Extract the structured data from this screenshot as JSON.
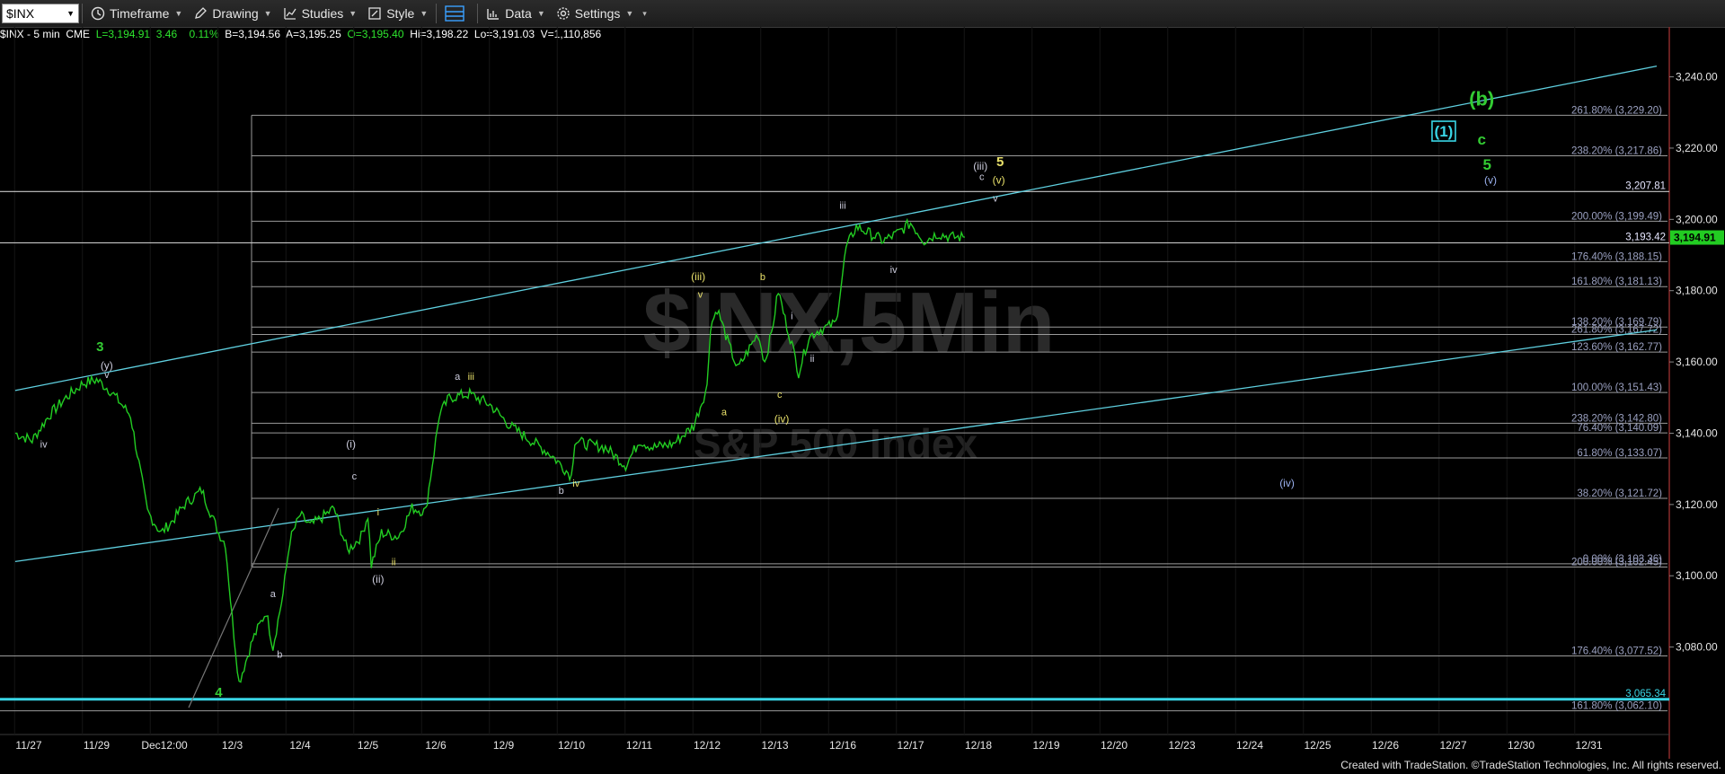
{
  "toolbar": {
    "symbol": "$INX",
    "items": [
      {
        "label": "Timeframe",
        "icon": "clock-icon"
      },
      {
        "label": "Drawing",
        "icon": "pencil-icon"
      },
      {
        "label": "Studies",
        "icon": "studies-icon"
      },
      {
        "label": "Style",
        "icon": "style-icon"
      },
      {
        "label": "Data",
        "icon": "data-icon"
      },
      {
        "label": "Settings",
        "icon": "gear-icon"
      }
    ]
  },
  "info": {
    "name": "$INX - 5 min  CME",
    "last": "L=3,194.91",
    "chg": "3.46",
    "pct": "0.11%",
    "bid": "B=3,194.56",
    "ask": "A=3,195.25",
    "open": "O=3,195.40",
    "hi": "Hi=3,198.22",
    "lo": "Lo=3,191.03",
    "vol": "V=1,110,856"
  },
  "watermark": {
    "symbol": "$INX,5Min",
    "name": "S&P 500 Index"
  },
  "footer": "Created with TradeStation. ©TradeStation Technologies, Inc. All rights reserved.",
  "colors": {
    "price": "#22cc22",
    "axis": "#8a2a2a",
    "channel": "#5fd0e0",
    "fib": "#9a9a9a",
    "cyan": "#39d6e6"
  },
  "chart_data": {
    "type": "line",
    "title": "$INX - 5 min",
    "ylim": [
      3060,
      3254
    ],
    "y_ticks": [
      "3,240.00",
      "3,220.00",
      "3,200.00",
      "3,180.00",
      "3,160.00",
      "3,140.00",
      "3,120.00",
      "3,100.00",
      "3,080.00"
    ],
    "y_tick_values": [
      3240,
      3220,
      3200,
      3180,
      3160,
      3140,
      3120,
      3100,
      3080
    ],
    "x_labels": [
      "11/27",
      "11/29",
      "Dec12:00",
      "12/3",
      "12/4",
      "12/5",
      "12/6",
      "12/9",
      "12/10",
      "12/11",
      "12/12",
      "12/13",
      "12/16",
      "12/17",
      "12/18",
      "12/19",
      "12/20",
      "12/23",
      "12/24",
      "12/25",
      "12/26",
      "12/27",
      "12/30",
      "12/31"
    ],
    "x_label_index": [
      0,
      1,
      2,
      3,
      4,
      5,
      6,
      7,
      8,
      9,
      10,
      11,
      12,
      13,
      14,
      15,
      16,
      17,
      18,
      19,
      20,
      21,
      22,
      23
    ],
    "series": [
      {
        "values_x": [
          -0.2,
          0.05,
          0.3,
          0.55,
          0.8,
          1.0,
          1.2,
          1.5,
          1.75,
          1.95,
          2.1,
          2.3,
          2.55,
          2.8,
          2.9,
          3.0,
          3.1,
          3.3,
          3.5,
          3.6,
          3.75,
          3.85,
          4.0,
          4.15,
          4.3,
          4.5,
          4.7,
          4.9,
          5.0,
          5.05,
          5.2,
          5.45,
          5.65,
          5.85,
          6.0,
          6.05,
          6.2,
          6.5,
          6.8,
          7.1,
          7.4,
          7.7,
          8.0,
          8.05,
          8.2,
          8.5,
          8.8,
          8.95,
          9.0,
          9.2,
          9.5,
          9.8,
          10.0,
          10.05,
          10.15,
          10.3,
          10.45,
          10.6,
          10.75,
          10.85,
          10.95,
          11.05,
          11.15,
          11.25,
          11.35,
          11.5,
          11.65,
          11.8,
          11.9,
          12.0,
          12.05,
          12.2,
          12.4,
          12.6,
          12.8,
          13.0,
          13.2,
          13.4,
          13.6,
          13.8
        ],
        "values_y": [
          3140,
          3138,
          3145,
          3150,
          3154,
          3155,
          3152,
          3145,
          3118,
          3112,
          3115,
          3120,
          3124,
          3112,
          3109,
          3088,
          3070,
          3082,
          3090,
          3080,
          3095,
          3110,
          3117,
          3114,
          3116,
          3119,
          3107,
          3111,
          3117,
          3103,
          3112,
          3111,
          3119,
          3118,
          3138,
          3145,
          3150,
          3151,
          3148,
          3142,
          3138,
          3134,
          3128,
          3138,
          3137,
          3136,
          3131,
          3136,
          3138,
          3136,
          3137,
          3142,
          3153,
          3170,
          3175,
          3166,
          3158,
          3163,
          3168,
          3160,
          3168,
          3180,
          3172,
          3165,
          3157,
          3167,
          3169,
          3170,
          3171,
          3185,
          3192,
          3198,
          3196,
          3194,
          3196,
          3199,
          3194,
          3196,
          3195,
          3195
        ]
      }
    ],
    "fib_levels": [
      {
        "label": "261.80% (3,229.20)",
        "value": 3229.2
      },
      {
        "label": "238.20% (3,217.86)",
        "value": 3217.86
      },
      {
        "label": "200.00% (3,199.49)",
        "value": 3199.49
      },
      {
        "label": "176.40% (3,188.15)",
        "value": 3188.15
      },
      {
        "label": "161.80% (3,181.13)",
        "value": 3181.13
      },
      {
        "label": "138.20% (3,169.79)",
        "value": 3169.79
      },
      {
        "label": "261.80% (3,167.72)",
        "value": 3167.72
      },
      {
        "label": "123.60% (3,162.77)",
        "value": 3162.77
      },
      {
        "label": "100.00% (3,151.43)",
        "value": 3151.43
      },
      {
        "label": "238.20% (3,142.80)",
        "value": 3142.8
      },
      {
        "label": "76.40% (3,140.09)",
        "value": 3140.09
      },
      {
        "label": "61.80% (3,133.07)",
        "value": 3133.07
      },
      {
        "label": "38.20% (3,121.72)",
        "value": 3121.72
      },
      {
        "label": "0.00% (3,103.36)",
        "value": 3103.36
      },
      {
        "label": "200.00% (3,102.45)",
        "value": 3102.45
      },
      {
        "label": "176.40% (3,077.52)",
        "value": 3077.52
      },
      {
        "label": "161.80% (3,062.10)",
        "value": 3062.1
      }
    ],
    "horizontal_lines": [
      {
        "label": "3,207.81",
        "value": 3207.81
      },
      {
        "label": "3,193.42",
        "value": 3193.42
      },
      {
        "label": "3,065.34",
        "value": 3065.34
      }
    ],
    "last_price": {
      "label": "3,194.91",
      "value": 3194.91
    },
    "channel_lines": [
      {
        "x": [
          -0.2,
          24.0
        ],
        "y": [
          3152,
          3243
        ]
      },
      {
        "x": [
          -0.2,
          24.0
        ],
        "y": [
          3104,
          3169
        ]
      }
    ],
    "annotations": [
      {
        "text": "3",
        "x": 1.05,
        "y": 3163,
        "color": "#33cc33",
        "size": 15
      },
      {
        "text": "(y)",
        "x": 1.15,
        "y": 3158,
        "color": "#ccccdd",
        "size": 12
      },
      {
        "text": "v",
        "x": 1.15,
        "y": 3155.5,
        "color": "#ccccdd",
        "size": 11
      },
      {
        "text": "iv",
        "x": 0.22,
        "y": 3136,
        "color": "#ccccdd",
        "size": 11
      },
      {
        "text": "4",
        "x": 2.8,
        "y": 3066,
        "color": "#33cc33",
        "size": 15
      },
      {
        "text": "a",
        "x": 3.6,
        "y": 3094,
        "color": "#ccccdd",
        "size": 11
      },
      {
        "text": "b",
        "x": 3.7,
        "y": 3077,
        "color": "#ccccdd",
        "size": 11
      },
      {
        "text": "(i)",
        "x": 4.75,
        "y": 3136,
        "color": "#ccccdd",
        "size": 12
      },
      {
        "text": "c",
        "x": 4.8,
        "y": 3127,
        "color": "#ccccdd",
        "size": 11
      },
      {
        "text": "i",
        "x": 5.15,
        "y": 3117,
        "color": "#e8e06a",
        "size": 11
      },
      {
        "text": "ii",
        "x": 5.38,
        "y": 3103,
        "color": "#e8e06a",
        "size": 11
      },
      {
        "text": "(ii)",
        "x": 5.15,
        "y": 3098,
        "color": "#ccccdd",
        "size": 12
      },
      {
        "text": "a",
        "x": 6.32,
        "y": 3155,
        "color": "#ccccdd",
        "size": 11
      },
      {
        "text": "iii",
        "x": 6.52,
        "y": 3155,
        "color": "#e8e06a",
        "size": 11
      },
      {
        "text": "b",
        "x": 7.85,
        "y": 3123,
        "color": "#ccccdd",
        "size": 11
      },
      {
        "text": "iv",
        "x": 8.07,
        "y": 3125,
        "color": "#e8e06a",
        "size": 11
      },
      {
        "text": "(iii)",
        "x": 9.87,
        "y": 3183,
        "color": "#e8e06a",
        "size": 12
      },
      {
        "text": "v",
        "x": 9.9,
        "y": 3178,
        "color": "#e8e06a",
        "size": 11
      },
      {
        "text": "a",
        "x": 10.25,
        "y": 3145,
        "color": "#e8e06a",
        "size": 11
      },
      {
        "text": "b",
        "x": 10.82,
        "y": 3183,
        "color": "#e8e06a",
        "size": 11
      },
      {
        "text": "i",
        "x": 11.25,
        "y": 3172,
        "color": "#ccccdd",
        "size": 11
      },
      {
        "text": "ii",
        "x": 11.55,
        "y": 3160,
        "color": "#ccccdd",
        "size": 11
      },
      {
        "text": "c",
        "x": 11.07,
        "y": 3150,
        "color": "#e8e06a",
        "size": 11
      },
      {
        "text": "(iv)",
        "x": 11.1,
        "y": 3143,
        "color": "#e8e06a",
        "size": 12
      },
      {
        "text": "iii",
        "x": 12.0,
        "y": 3203,
        "color": "#ccccdd",
        "size": 11
      },
      {
        "text": "iv",
        "x": 12.75,
        "y": 3185,
        "color": "#ccccdd",
        "size": 11
      },
      {
        "text": "(iii)",
        "x": 14.03,
        "y": 3214,
        "color": "#ccccdd",
        "size": 12
      },
      {
        "text": "c",
        "x": 14.05,
        "y": 3211,
        "color": "#ccccdd",
        "size": 11
      },
      {
        "text": "5",
        "x": 14.32,
        "y": 3215,
        "color": "#e8e06a",
        "size": 15
      },
      {
        "text": "(v)",
        "x": 14.3,
        "y": 3210,
        "color": "#e8e06a",
        "size": 12
      },
      {
        "text": "v",
        "x": 14.25,
        "y": 3205,
        "color": "#ccccdd",
        "size": 11
      },
      {
        "text": "(iv)",
        "x": 18.55,
        "y": 3125,
        "color": "#9ab0ee",
        "size": 12
      },
      {
        "text": "(v)",
        "x": 21.55,
        "y": 3210,
        "color": "#9ab0ee",
        "size": 12
      },
      {
        "text": "(b)",
        "x": 21.42,
        "y": 3232,
        "color": "#33cc33",
        "size": 22
      },
      {
        "text": "c",
        "x": 21.42,
        "y": 3221,
        "color": "#33cc33",
        "size": 17
      },
      {
        "text": "5",
        "x": 21.5,
        "y": 3214,
        "color": "#33cc33",
        "size": 17
      }
    ],
    "boxed_label": {
      "text": "(1)",
      "x": 20.86,
      "y": 3223,
      "color": "#39d6e6"
    }
  }
}
